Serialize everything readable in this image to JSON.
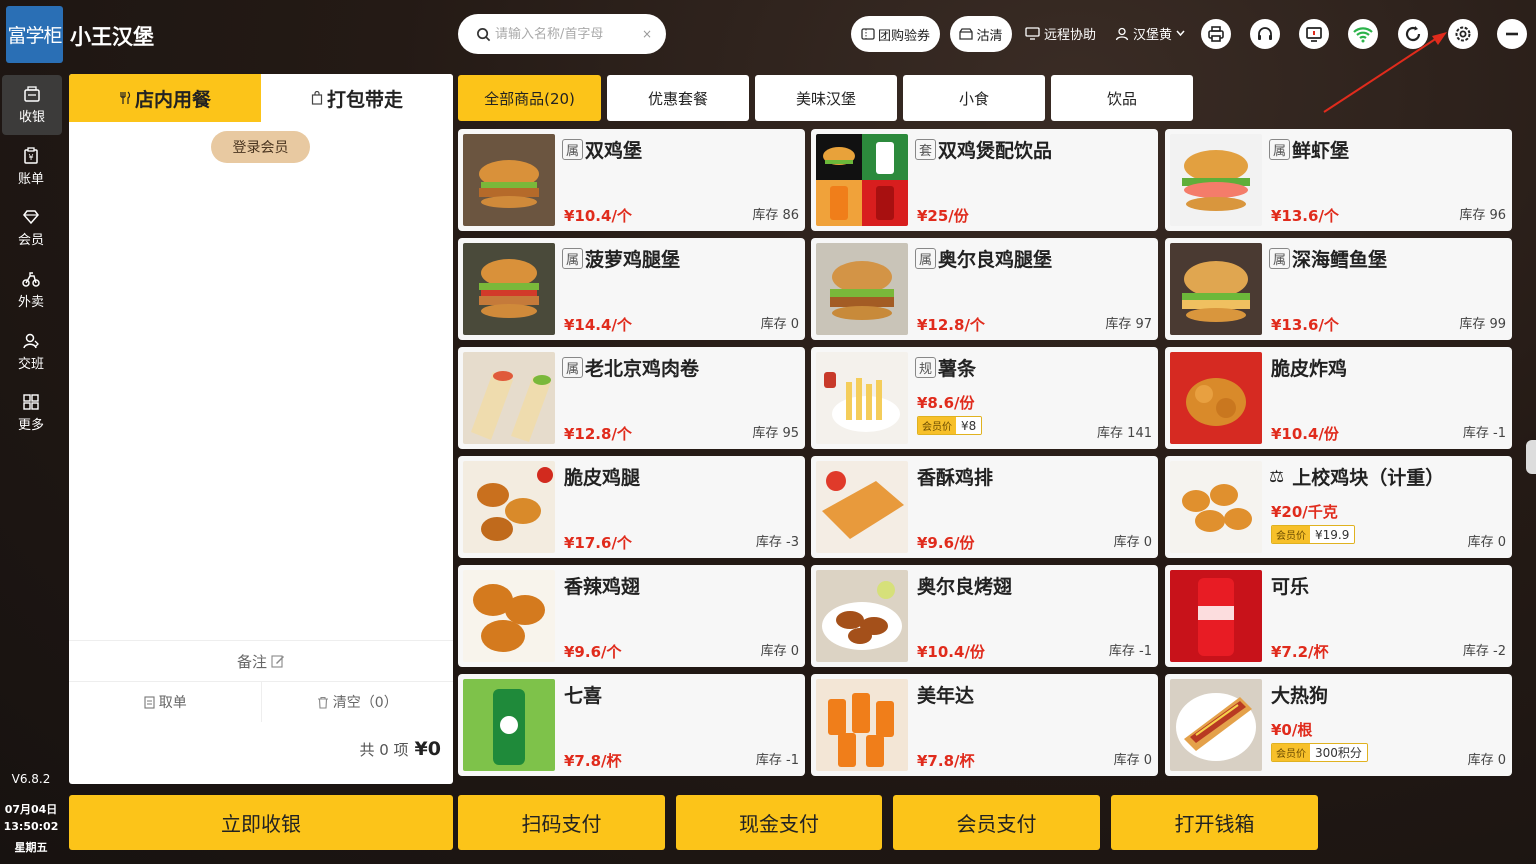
{
  "app": {
    "logo": "富学柜",
    "shop_name": "小王汉堡"
  },
  "search": {
    "placeholder": "请输入名称/首字母",
    "clear_icon": "×"
  },
  "header": {
    "group_buy": "团购验券",
    "clear": "沽清",
    "remote": "远程协助",
    "user": "汉堡黄"
  },
  "sidebar": {
    "items": [
      {
        "label": "收银",
        "icon": "cashier-icon"
      },
      {
        "label": "账单",
        "icon": "bill-icon"
      },
      {
        "label": "会员",
        "icon": "member-icon"
      },
      {
        "label": "外卖",
        "icon": "delivery-icon"
      },
      {
        "label": "交班",
        "icon": "shift-icon"
      },
      {
        "label": "更多",
        "icon": "more-icon"
      }
    ],
    "version": "V6.8.2",
    "date": "07月04日",
    "time": "13:50:02",
    "weekday": "星期五"
  },
  "order": {
    "tab_dine_in": "店内用餐",
    "tab_takeaway": "打包带走",
    "login_member": "登录会员",
    "notes": "备注",
    "take_order": "取单",
    "clear": "清空（0）",
    "total_count": "共 0 项",
    "total_amount": "¥0"
  },
  "categories": [
    "全部商品(20)",
    "优惠套餐",
    "美味汉堡",
    "小食",
    "饮品"
  ],
  "products": [
    {
      "tag": "属",
      "name": "双鸡堡",
      "price": "¥10.4/个",
      "stock": "库存 86",
      "img": "burger",
      "member": "",
      "member_price": ""
    },
    {
      "tag": "套",
      "name": "双鸡煲配饮品",
      "price": "¥25/份",
      "stock": "",
      "img": "combo",
      "member": "",
      "member_price": ""
    },
    {
      "tag": "属",
      "name": "鲜虾堡",
      "price": "¥13.6/个",
      "stock": "库存 96",
      "img": "shrimp",
      "member": "",
      "member_price": ""
    },
    {
      "tag": "属",
      "name": "菠萝鸡腿堡",
      "price": "¥14.4/个",
      "stock": "库存 0",
      "img": "burger2",
      "member": "",
      "member_price": ""
    },
    {
      "tag": "属",
      "name": "奥尔良鸡腿堡",
      "price": "¥12.8/个",
      "stock": "库存 97",
      "img": "burger3",
      "member": "",
      "member_price": ""
    },
    {
      "tag": "属",
      "name": "深海鳕鱼堡",
      "price": "¥13.6/个",
      "stock": "库存 99",
      "img": "fish",
      "member": "",
      "member_price": ""
    },
    {
      "tag": "属",
      "name": "老北京鸡肉卷",
      "price": "¥12.8/个",
      "stock": "库存 95",
      "img": "wrap",
      "member": "",
      "member_price": ""
    },
    {
      "tag": "规",
      "name": "薯条",
      "price": "¥8.6/份",
      "stock": "库存 141",
      "img": "fries",
      "member": "会员价",
      "member_price": "¥8"
    },
    {
      "tag": "",
      "name": "脆皮炸鸡",
      "price": "¥10.4/份",
      "stock": "库存 -1",
      "img": "fried",
      "member": "",
      "member_price": ""
    },
    {
      "tag": "",
      "name": "脆皮鸡腿",
      "price": "¥17.6/个",
      "stock": "库存 -3",
      "img": "drum",
      "member": "",
      "member_price": ""
    },
    {
      "tag": "",
      "name": "香酥鸡排",
      "price": "¥9.6/份",
      "stock": "库存 0",
      "img": "cutlet",
      "member": "",
      "member_price": ""
    },
    {
      "tag": "⚖",
      "name": "上校鸡块（计重）",
      "price": "¥20/千克",
      "stock": "库存 0",
      "img": "nugget",
      "member": "会员价",
      "member_price": "¥19.9"
    },
    {
      "tag": "",
      "name": "香辣鸡翅",
      "price": "¥9.6/个",
      "stock": "库存 0",
      "img": "wings",
      "member": "",
      "member_price": ""
    },
    {
      "tag": "",
      "name": "奥尔良烤翅",
      "price": "¥10.4/份",
      "stock": "库存 -1",
      "img": "roast",
      "member": "",
      "member_price": ""
    },
    {
      "tag": "",
      "name": "可乐",
      "price": "¥7.2/杯",
      "stock": "库存 -2",
      "img": "cola",
      "member": "",
      "member_price": ""
    },
    {
      "tag": "",
      "name": "七喜",
      "price": "¥7.8/杯",
      "stock": "库存 -1",
      "img": "sprite",
      "member": "",
      "member_price": ""
    },
    {
      "tag": "",
      "name": "美年达",
      "price": "¥7.8/杯",
      "stock": "库存 0",
      "img": "mirinda",
      "member": "",
      "member_price": ""
    },
    {
      "tag": "",
      "name": "大热狗",
      "price": "¥0/根",
      "stock": "库存 0",
      "img": "hotdog",
      "member": "会员价",
      "member_price": "300积分"
    }
  ],
  "payment": {
    "checkout": "立即收银",
    "scan": "扫码支付",
    "cash": "现金支付",
    "member": "会员支付",
    "drawer": "打开钱箱"
  },
  "colors": {
    "accent": "#fcc419",
    "price": "#e02b1c",
    "logo": "#2a6fb5"
  }
}
